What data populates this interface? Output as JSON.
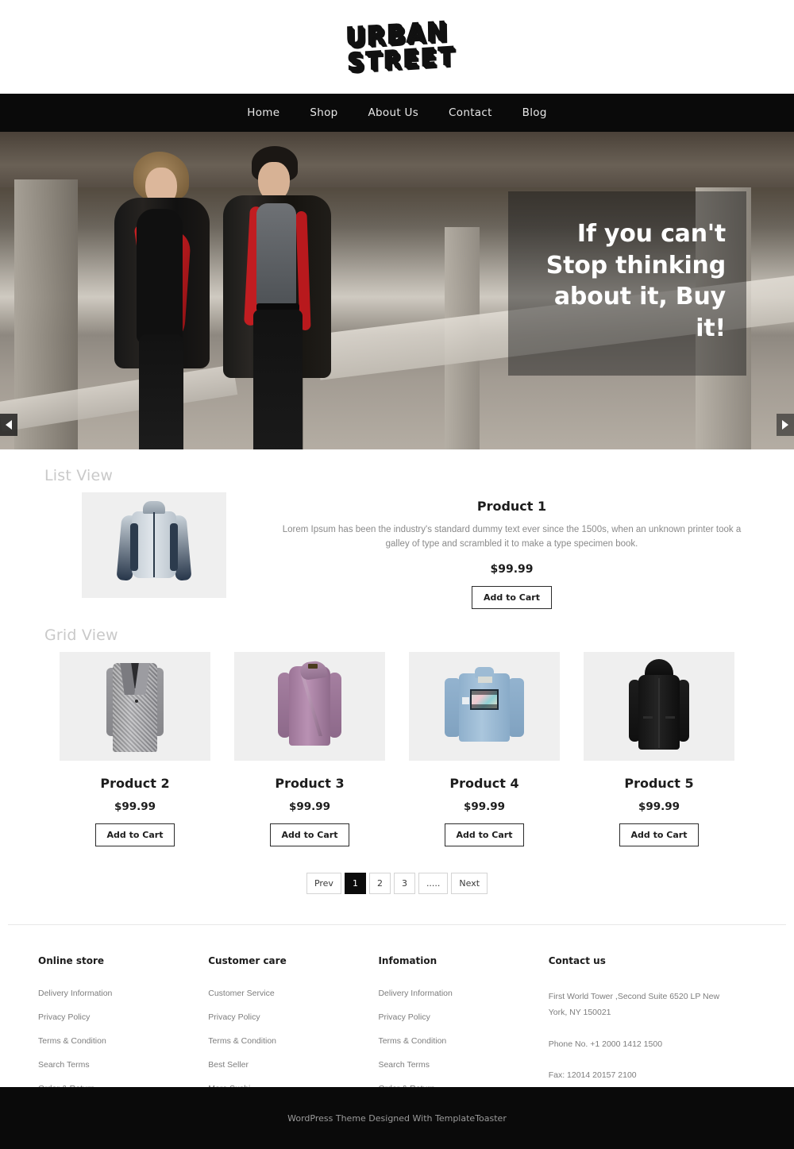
{
  "header": {
    "logo_line1": "URBAN",
    "logo_line2": "STREET"
  },
  "nav": {
    "items": [
      {
        "label": "Home"
      },
      {
        "label": "Shop"
      },
      {
        "label": "About Us"
      },
      {
        "label": "Contact"
      },
      {
        "label": "Blog"
      }
    ]
  },
  "hero": {
    "caption": "If you can't Stop thinking about it, Buy it!",
    "prev_icon": "arrow-left-icon",
    "next_icon": "arrow-right-icon",
    "image_alt": "couple running under concrete overpass wearing black coats with red lining"
  },
  "list_section": {
    "heading": "List View",
    "product": {
      "title": "Product 1",
      "description": "Lorem Ipsum has been the industry's standard dummy text ever since the 1500s, when an unknown printer took a galley of type and scrambled it to make a type specimen book.",
      "price": "$99.99",
      "cart_label": "Add to Cart",
      "image_alt": "light blue and navy windbreaker jacket"
    }
  },
  "grid_section": {
    "heading": "Grid View",
    "products": [
      {
        "title": "Product 2",
        "price": "$99.99",
        "cart_label": "Add to Cart",
        "image_alt": "gray tweed long coat"
      },
      {
        "title": "Product 3",
        "price": "$99.99",
        "cart_label": "Add to Cart",
        "image_alt": "purple asymmetric zip cardigan"
      },
      {
        "title": "Product 4",
        "price": "$99.99",
        "cart_label": "Add to Cart",
        "image_alt": "blue denim jacket with graphic patch"
      },
      {
        "title": "Product 5",
        "price": "$99.99",
        "cart_label": "Add to Cart",
        "image_alt": "black hooded parka"
      }
    ]
  },
  "pagination": {
    "prev_label": "Prev",
    "next_label": "Next",
    "pages": [
      "1",
      "2",
      "3",
      "....."
    ],
    "active_page": "1"
  },
  "footer": {
    "columns": [
      {
        "title": "Online store",
        "links": [
          "Delivery Information",
          "Privacy Policy",
          "Terms & Condition",
          "Search Terms",
          "Order & Return"
        ]
      },
      {
        "title": "Customer care",
        "links": [
          "Customer Service",
          "Privacy Policy",
          "Terms & Condition",
          "Best Seller",
          "More Sushi"
        ]
      },
      {
        "title": "Infomation",
        "links": [
          "Delivery Information",
          "Privacy Policy",
          "Terms & Condition",
          "Search Terms",
          "Order & Return"
        ]
      }
    ],
    "contact": {
      "title": "Contact us",
      "address": "First World Tower ,Second Suite 6520 LP New York, NY 150021",
      "phone": "Phone No. +1 2000 1412 1500",
      "fax": "Fax: 12014 20157 2100"
    },
    "bottom_text": "WordPress Theme Designed With TemplateToaster"
  },
  "colors": {
    "nav_bg": "#0a0a0a",
    "accent_dark": "#0b0b0b",
    "muted_text": "#7d7d7d",
    "heading_gray": "#c9c9c9",
    "thumb_bg": "#efefef"
  }
}
